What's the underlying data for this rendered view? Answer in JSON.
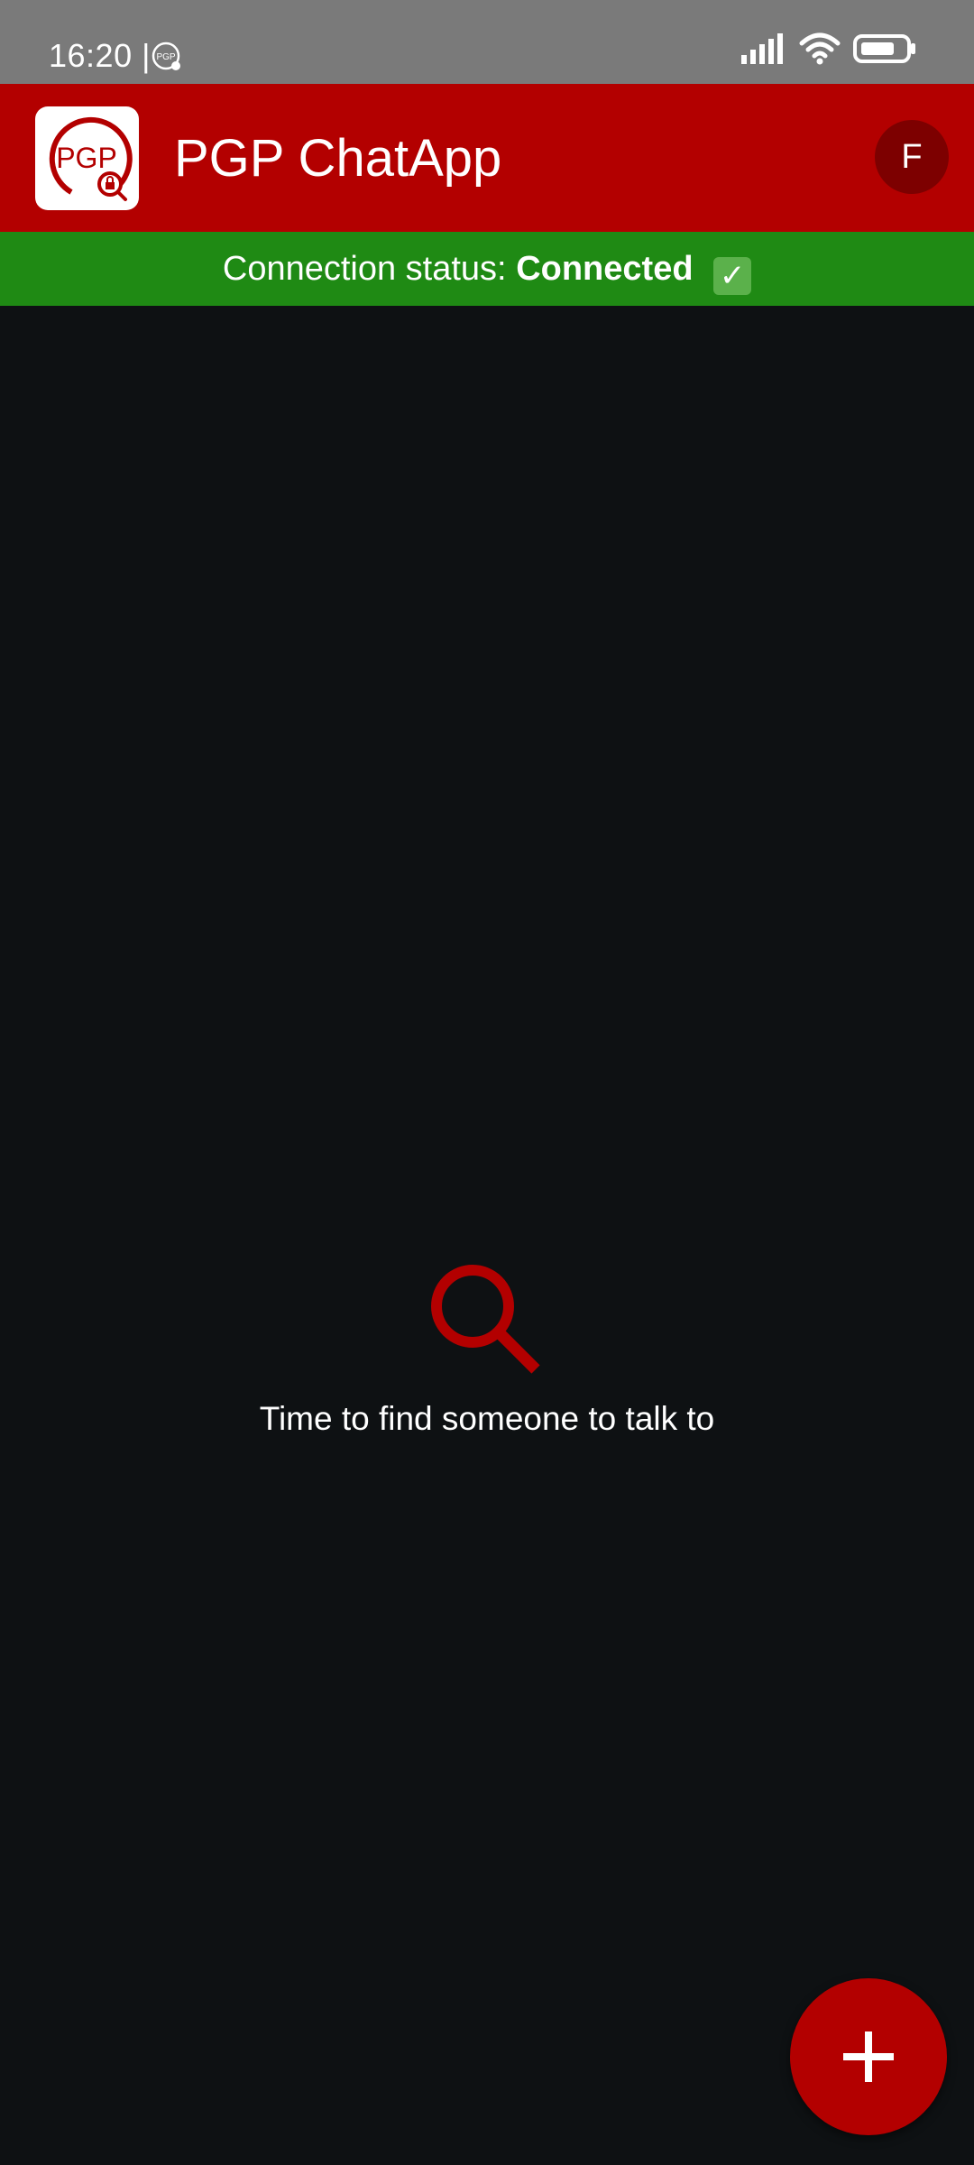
{
  "status_bar": {
    "time": "16:20 |",
    "notification_icon": "pgp-app-icon",
    "signal_icon": "signal-icon",
    "wifi_icon": "wifi-icon",
    "battery_icon": "battery-icon"
  },
  "app_bar": {
    "logo_text": "PGP",
    "title": "PGP ChatApp",
    "avatar_initial": "F"
  },
  "connection": {
    "label": "Connection status:",
    "value": "Connected",
    "check": "✓"
  },
  "empty_state": {
    "icon": "search-icon",
    "message": "Time to find someone to talk to"
  },
  "fab": {
    "icon": "plus-icon"
  },
  "colors": {
    "status_bar": "#7a7a7a",
    "app_bar": "#b30000",
    "connection_bar": "#1f8a14",
    "background": "#0e1113",
    "accent": "#b30000"
  }
}
